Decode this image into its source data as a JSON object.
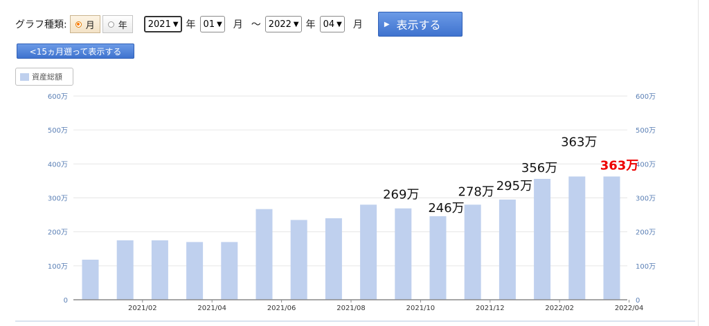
{
  "controls": {
    "graph_type_label": "グラフ種類:",
    "radio_month": "月",
    "radio_year": "年",
    "selected_type": "月",
    "from_year": "2021",
    "year_unit": "年",
    "from_month": "01",
    "month_unit": "月",
    "range_sep": "〜",
    "to_year": "2022",
    "to_month": "04",
    "show_button": "表示する",
    "back_button": "<15ヵ月遡って表示する"
  },
  "colors": {
    "bar": "#bfd0ee",
    "highlight_label": "#ee0000",
    "axis_text": "#5a7fb5",
    "grid": "#e6e6e6",
    "button": "#4a7fd9"
  },
  "chart_data": {
    "type": "bar",
    "legend": [
      "資産総額"
    ],
    "series": [
      {
        "name": "資産総額",
        "values": [
          118,
          175,
          175,
          170,
          170,
          267,
          235,
          240,
          280,
          269,
          246,
          280,
          295,
          356,
          363,
          363
        ]
      }
    ],
    "x_tick_labels": [
      "2021/02",
      "2021/04",
      "2021/06",
      "2021/08",
      "2021/10",
      "2021/12",
      "2022/02",
      "2022/04"
    ],
    "x_tick_positions": [
      1,
      3,
      5,
      7,
      9,
      11,
      13,
      15
    ],
    "y_tick_labels": [
      "0",
      "100万",
      "200万",
      "300万",
      "400万",
      "500万",
      "600万"
    ],
    "ylim": [
      0,
      600
    ],
    "y_unit": "万",
    "right_axis_mirror": true,
    "grid": true,
    "data_labels": [
      {
        "text": "269万",
        "index": 9,
        "highlight": false
      },
      {
        "text": "246万",
        "index": 10,
        "highlight": false
      },
      {
        "text": "278万",
        "index": 11,
        "highlight": false
      },
      {
        "text": "295万",
        "index": 12,
        "highlight": false
      },
      {
        "text": "356万",
        "index": 13,
        "highlight": false
      },
      {
        "text": "363万",
        "index": 14,
        "highlight": false
      },
      {
        "text": "363万",
        "index": 15,
        "highlight": true
      }
    ]
  }
}
